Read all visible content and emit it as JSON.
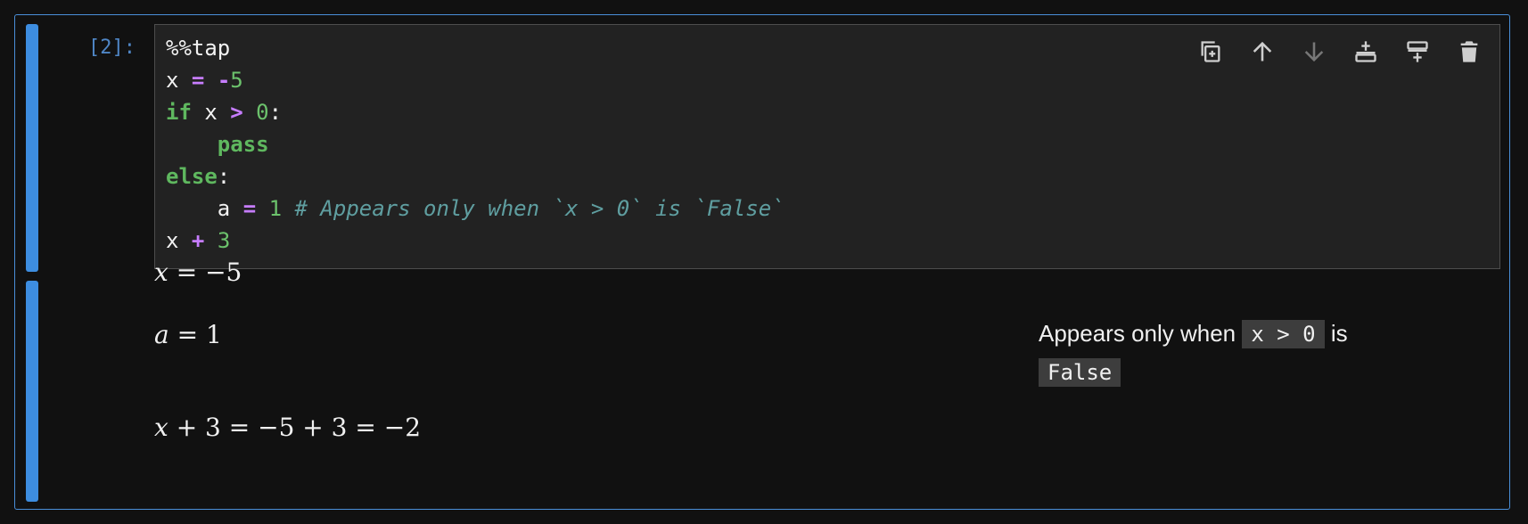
{
  "cell": {
    "prompt": "[2]:",
    "code_lines": [
      [
        {
          "t": "%%tap",
          "c": ""
        }
      ],
      [
        {
          "t": "x ",
          "c": ""
        },
        {
          "t": "=",
          "c": "op"
        },
        {
          "t": " ",
          "c": ""
        },
        {
          "t": "-",
          "c": "op"
        },
        {
          "t": "5",
          "c": "num"
        }
      ],
      [
        {
          "t": "if",
          "c": "kw"
        },
        {
          "t": " x ",
          "c": ""
        },
        {
          "t": ">",
          "c": "op"
        },
        {
          "t": " ",
          "c": ""
        },
        {
          "t": "0",
          "c": "num"
        },
        {
          "t": ":",
          "c": ""
        }
      ],
      [
        {
          "t": "    ",
          "c": ""
        },
        {
          "t": "pass",
          "c": "kw"
        }
      ],
      [
        {
          "t": "else",
          "c": "kw"
        },
        {
          "t": ":",
          "c": ""
        }
      ],
      [
        {
          "t": "    a ",
          "c": ""
        },
        {
          "t": "=",
          "c": "op"
        },
        {
          "t": " ",
          "c": ""
        },
        {
          "t": "1",
          "c": "num"
        },
        {
          "t": " ",
          "c": ""
        },
        {
          "t": "# Appears only when `x > 0` is `False`",
          "c": "cmt"
        }
      ],
      [
        {
          "t": "x ",
          "c": ""
        },
        {
          "t": "+",
          "c": "op"
        },
        {
          "t": " ",
          "c": ""
        },
        {
          "t": "3",
          "c": "num"
        }
      ]
    ],
    "toolbar": [
      {
        "name": "duplicate-cell-button",
        "icon": "copy-plus-icon",
        "color": "#cfcfcf"
      },
      {
        "name": "move-up-button",
        "icon": "arrow-up-icon",
        "color": "#cfcfcf"
      },
      {
        "name": "move-down-button",
        "icon": "arrow-down-icon",
        "color": "#777777"
      },
      {
        "name": "insert-above-button",
        "icon": "insert-above-icon",
        "color": "#cfcfcf"
      },
      {
        "name": "insert-below-button",
        "icon": "insert-below-icon",
        "color": "#cfcfcf"
      },
      {
        "name": "delete-cell-button",
        "icon": "trash-icon",
        "color": "#cfcfcf"
      }
    ]
  },
  "output": {
    "line1": {
      "lhs": "x",
      "eq": " = ",
      "rhs": "−5"
    },
    "line2": {
      "lhs": "a",
      "eq": " = ",
      "rhs": "1"
    },
    "line3": {
      "lhs": "x",
      "rest": " + 3 = −5 + 3 = −2"
    },
    "annotation": {
      "prefix": "Appears only when ",
      "code1": "x > 0",
      "middle": " is",
      "code2": "False"
    }
  },
  "colors": {
    "accent": "#3d8de0",
    "border": "#4a8fd9",
    "keyword": "#5fb85f",
    "operator": "#c77dff",
    "comment": "#5f9ea0"
  }
}
